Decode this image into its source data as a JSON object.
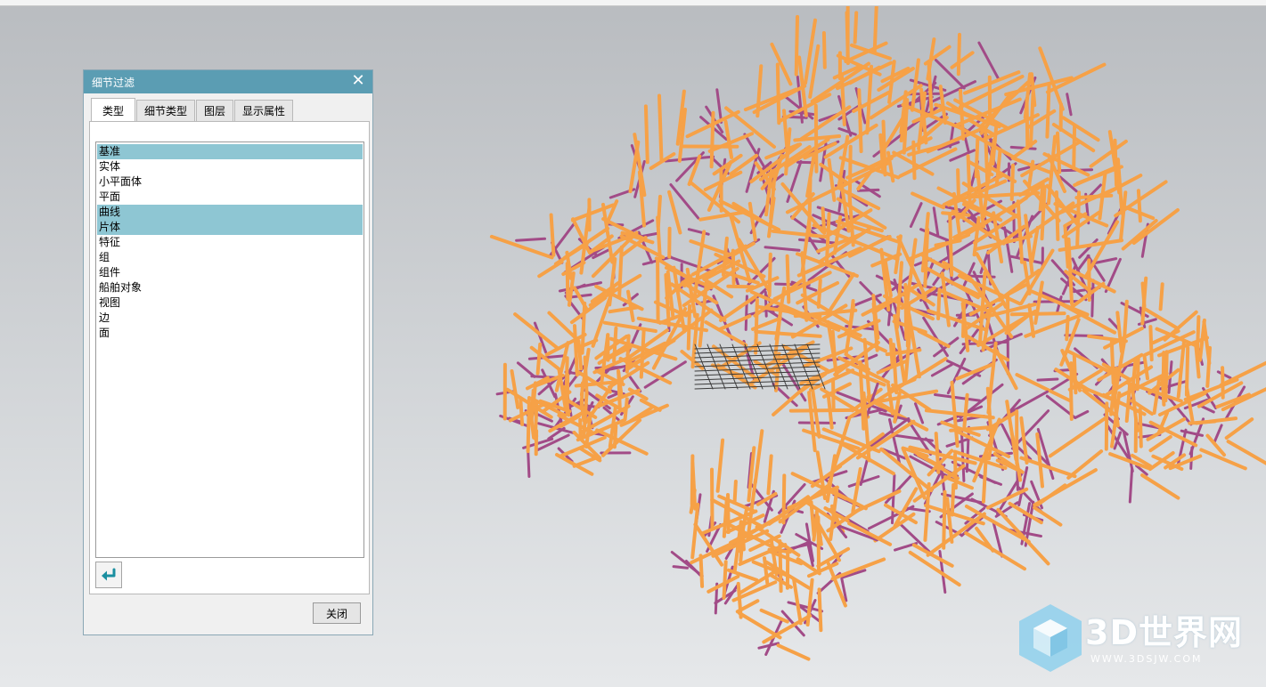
{
  "dialog": {
    "title": "细节过滤",
    "close_glyph": "✕",
    "tabs": [
      {
        "label": "类型",
        "active": true
      },
      {
        "label": "细节类型",
        "active": false
      },
      {
        "label": "图层",
        "active": false
      },
      {
        "label": "显示属性",
        "active": false
      }
    ],
    "type_list": [
      {
        "label": "基准",
        "selected": true
      },
      {
        "label": "实体",
        "selected": false
      },
      {
        "label": "小平面体",
        "selected": false
      },
      {
        "label": "平面",
        "selected": false
      },
      {
        "label": "曲线",
        "selected": true
      },
      {
        "label": "片体",
        "selected": true
      },
      {
        "label": "特征",
        "selected": false
      },
      {
        "label": "组",
        "selected": false
      },
      {
        "label": "组件",
        "selected": false
      },
      {
        "label": "船舶对象",
        "selected": false
      },
      {
        "label": "视图",
        "selected": false
      },
      {
        "label": "边",
        "selected": false
      },
      {
        "label": "面",
        "selected": false
      }
    ],
    "back_icon": "return-arrow-icon",
    "close_button_label": "关闭"
  },
  "viewport": {
    "model_colors": {
      "beam": "#f6a147",
      "brace": "#a24b87",
      "detail": "#3a3a3a"
    }
  },
  "watermark": {
    "title": "3D世界网",
    "subtitle": "WWW.3DSJW.COM",
    "icon": "cube-logo-icon"
  },
  "colors": {
    "dialog_header": "#5b9db3",
    "selection": "#8ec6d3"
  }
}
